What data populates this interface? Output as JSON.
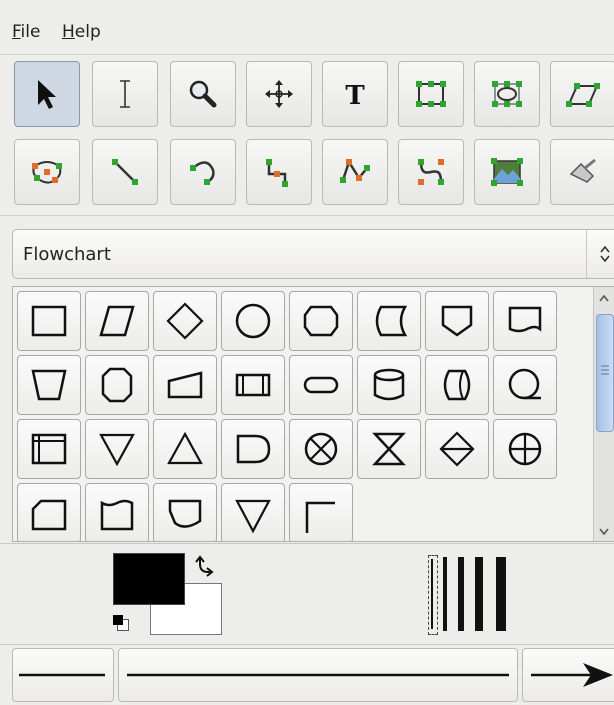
{
  "menu": {
    "file_label": "File",
    "file_accel": "F",
    "file_rest": "ile",
    "help_label": "Help",
    "help_accel": "H",
    "help_rest": "elp"
  },
  "toolbox_row1": [
    {
      "icon": "pointer-icon",
      "active": true
    },
    {
      "icon": "text-cursor-icon"
    },
    {
      "icon": "magnify-icon"
    },
    {
      "icon": "move-icon"
    },
    {
      "icon": "text-tool-icon",
      "text": "T"
    },
    {
      "icon": "box-icon"
    },
    {
      "icon": "ellipse-icon"
    },
    {
      "icon": "polygon-icon"
    }
  ],
  "toolbox_row2": [
    {
      "icon": "beziergon-icon"
    },
    {
      "icon": "line-icon"
    },
    {
      "icon": "arc-icon"
    },
    {
      "icon": "zigzag-line-icon"
    },
    {
      "icon": "polyline-icon"
    },
    {
      "icon": "bezier-line-icon"
    },
    {
      "icon": "image-icon"
    },
    {
      "icon": "outline-icon"
    }
  ],
  "sheet_selector": {
    "value": "Flowchart"
  },
  "colors": {
    "foreground": "#000000",
    "background": "#ffffff",
    "accent_handle": "#2ea52e",
    "accent_handle_alt": "#e06c2c"
  },
  "line_widths": [
    "thin",
    "medium",
    "thick",
    "thicker"
  ],
  "line_bar": {
    "start": "plain-line",
    "style": "solid-line",
    "end": "arrow-end"
  }
}
